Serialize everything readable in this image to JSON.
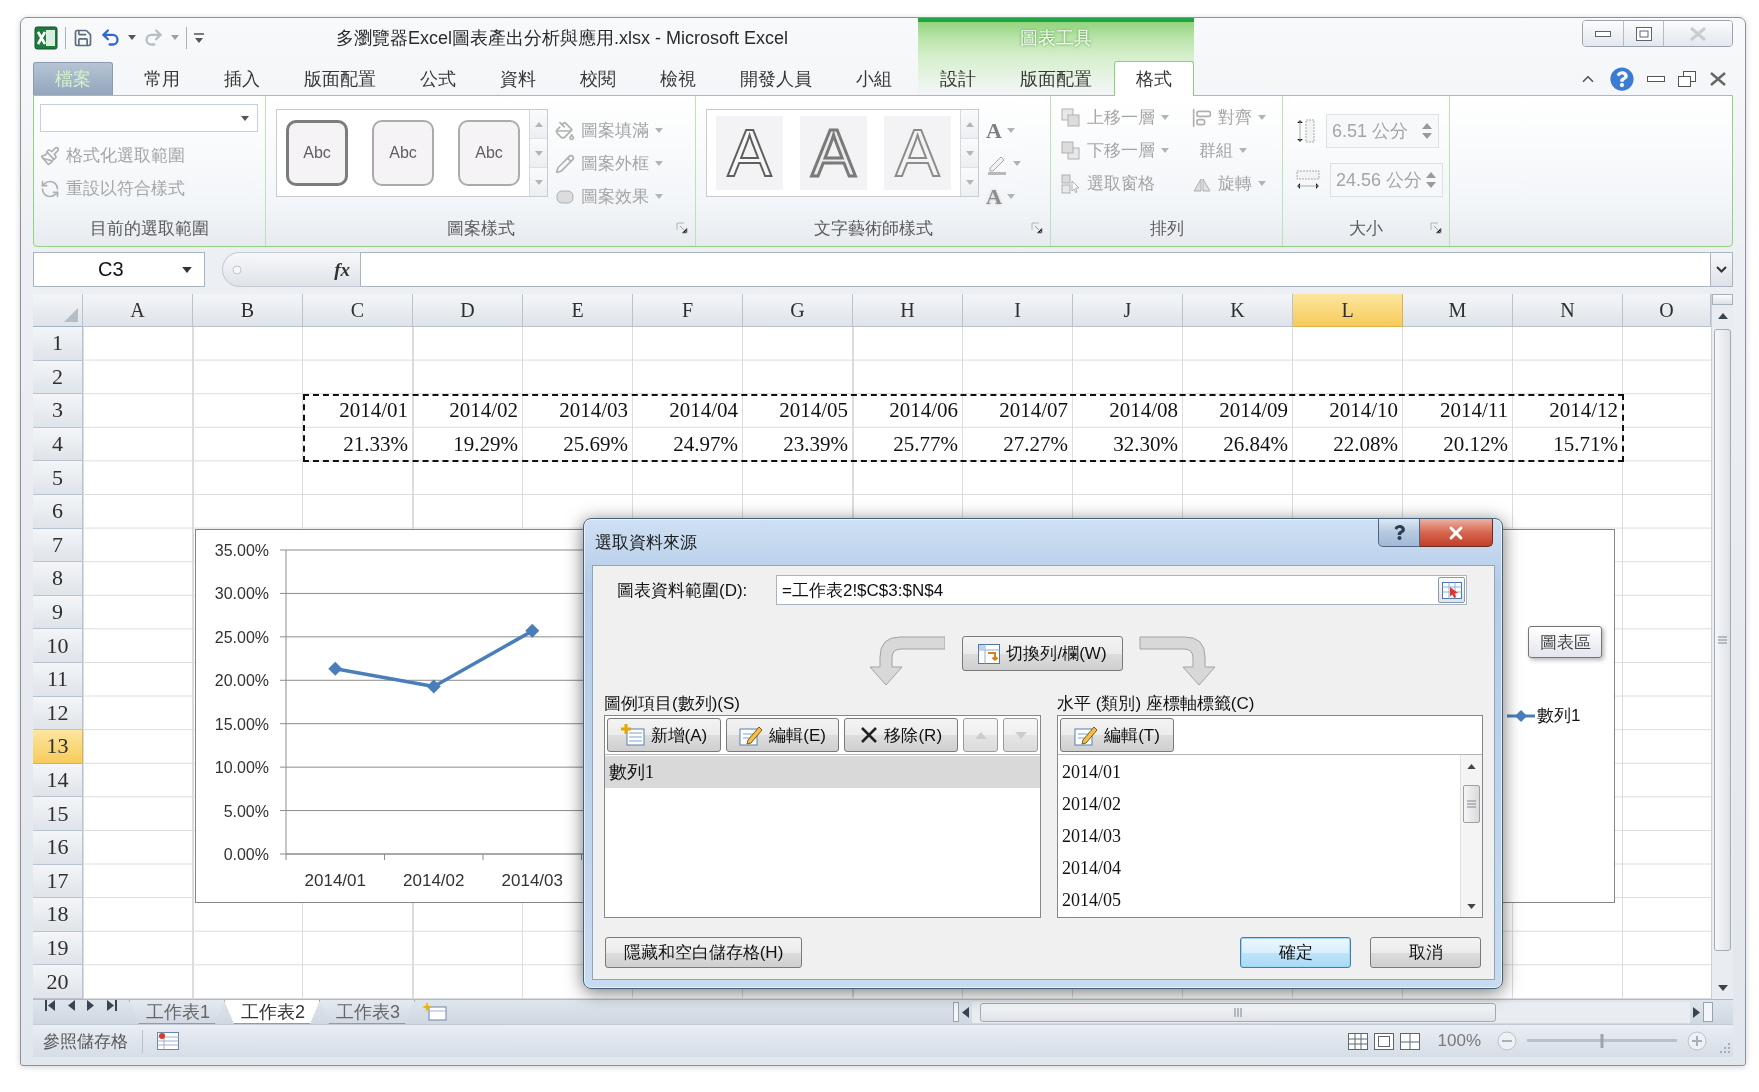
{
  "window": {
    "title": "多瀏覽器Excel圖表產出分析與應用.xlsx - Microsoft Excel",
    "context_header": "圖表工具"
  },
  "quick_access": [
    {
      "kind": "save",
      "disabled": false
    },
    {
      "kind": "undo",
      "disabled": false
    },
    {
      "kind": "redo",
      "disabled": true
    }
  ],
  "tabs": [
    {
      "label": "檔案",
      "kind": "file",
      "selected": false
    },
    {
      "label": "常用",
      "kind": "main",
      "selected": false
    },
    {
      "label": "插入",
      "kind": "main",
      "selected": false
    },
    {
      "label": "版面配置",
      "kind": "main",
      "selected": false
    },
    {
      "label": "公式",
      "kind": "main",
      "selected": false
    },
    {
      "label": "資料",
      "kind": "main",
      "selected": false
    },
    {
      "label": "校閱",
      "kind": "main",
      "selected": false
    },
    {
      "label": "檢視",
      "kind": "main",
      "selected": false
    },
    {
      "label": "開發人員",
      "kind": "main",
      "selected": false
    },
    {
      "label": "小組",
      "kind": "main",
      "selected": false
    },
    {
      "label": "設計",
      "kind": "context",
      "selected": false
    },
    {
      "label": "版面配置",
      "kind": "context",
      "selected": false
    },
    {
      "label": "格式",
      "kind": "context",
      "selected": true
    }
  ],
  "ribbon": {
    "disabled": true,
    "groups": [
      {
        "kind": "selection",
        "label": "目前的選取範圍",
        "launcher": false,
        "commands": [
          {
            "kind": "format_selection",
            "label": "格式化選取範圍",
            "dropdown": false
          },
          {
            "kind": "reset_style",
            "label": "重設以符合樣式",
            "dropdown": false
          }
        ]
      },
      {
        "kind": "shape_styles",
        "label": "圖案樣式",
        "launcher": true,
        "gallery": [
          {
            "label": "Abc",
            "kind": "bold_outline"
          },
          {
            "label": "Abc",
            "kind": "thin_outline"
          },
          {
            "label": "Abc",
            "kind": "thin_outline"
          }
        ],
        "commands": [
          {
            "kind": "shape_fill",
            "label": "圖案填滿",
            "dropdown": true
          },
          {
            "kind": "shape_outline",
            "label": "圖案外框",
            "dropdown": true
          },
          {
            "kind": "shape_effects",
            "label": "圖案效果",
            "dropdown": true
          }
        ]
      },
      {
        "kind": "wordart_styles",
        "label": "文字藝術師樣式",
        "launcher": true,
        "gallery": [
          {
            "label": "A",
            "kind": "outline"
          },
          {
            "label": "A",
            "kind": "thick_outline"
          },
          {
            "label": "A",
            "kind": "soft_outline"
          }
        ],
        "tools": [
          {
            "kind": "text_fill",
            "glyph": "A",
            "dropdown": true
          },
          {
            "kind": "text_outline",
            "dropdown": true
          },
          {
            "kind": "text_effects",
            "glyph": "A",
            "dropdown": true
          }
        ]
      },
      {
        "kind": "arrange",
        "label": "排列",
        "launcher": false,
        "commands": [
          {
            "kind": "bring_forward",
            "label": "上移一層",
            "dropdown": true
          },
          {
            "kind": "send_backward",
            "label": "下移一層",
            "dropdown": true
          },
          {
            "kind": "selection_pane",
            "label": "選取窗格",
            "dropdown": false
          },
          {
            "kind": "align",
            "label": "對齊",
            "dropdown": true
          },
          {
            "kind": "group",
            "label": "群組",
            "dropdown": true
          },
          {
            "kind": "rotate",
            "label": "旋轉",
            "dropdown": true
          }
        ]
      },
      {
        "kind": "size",
        "label": "大小",
        "launcher": true,
        "fields": [
          {
            "kind": "height",
            "value": "6.51 公分"
          },
          {
            "kind": "width",
            "value": "24.56 公分"
          }
        ]
      }
    ]
  },
  "formula_bar": {
    "name_box": "C3",
    "function_label": "fx"
  },
  "sheet": {
    "marquee": true,
    "columns": [
      {
        "label": "A",
        "selected": false
      },
      {
        "label": "B",
        "selected": false
      },
      {
        "label": "C",
        "selected": false
      },
      {
        "label": "D",
        "selected": false
      },
      {
        "label": "E",
        "selected": false
      },
      {
        "label": "F",
        "selected": false
      },
      {
        "label": "G",
        "selected": false
      },
      {
        "label": "H",
        "selected": false
      },
      {
        "label": "I",
        "selected": false
      },
      {
        "label": "J",
        "selected": false
      },
      {
        "label": "K",
        "selected": false
      },
      {
        "label": "L",
        "selected": true
      },
      {
        "label": "M",
        "selected": false
      },
      {
        "label": "N",
        "selected": false
      },
      {
        "label": "O",
        "selected": false
      }
    ],
    "rows": [
      {
        "label": "1",
        "selected": false
      },
      {
        "label": "2",
        "selected": false
      },
      {
        "label": "3",
        "selected": false,
        "cells": [
          null,
          null,
          "2014/01",
          "2014/02",
          "2014/03",
          "2014/04",
          "2014/05",
          "2014/06",
          "2014/07",
          "2014/08",
          "2014/09",
          "2014/10",
          "2014/11",
          "2014/12"
        ]
      },
      {
        "label": "4",
        "selected": false,
        "cells": [
          null,
          null,
          "21.33%",
          "19.29%",
          "25.69%",
          "24.97%",
          "23.39%",
          "25.77%",
          "27.27%",
          "32.30%",
          "26.84%",
          "22.08%",
          "20.12%",
          "15.71%"
        ]
      },
      {
        "label": "5",
        "selected": false
      },
      {
        "label": "6",
        "selected": false
      },
      {
        "label": "7",
        "selected": false
      },
      {
        "label": "8",
        "selected": false
      },
      {
        "label": "9",
        "selected": false
      },
      {
        "label": "10",
        "selected": false
      },
      {
        "label": "11",
        "selected": false
      },
      {
        "label": "12",
        "selected": false
      },
      {
        "label": "13",
        "selected": true
      },
      {
        "label": "14",
        "selected": false
      },
      {
        "label": "15",
        "selected": false
      },
      {
        "label": "16",
        "selected": false
      },
      {
        "label": "17",
        "selected": false
      },
      {
        "label": "18",
        "selected": false
      },
      {
        "label": "19",
        "selected": false
      },
      {
        "label": "20",
        "selected": false
      }
    ]
  },
  "chart": {
    "tooltip": "圖表區",
    "chart_data": {
      "type": "line",
      "grid": true,
      "categories": [
        "2014/01",
        "2014/02",
        "2014/03"
      ],
      "series": [
        {
          "name": "數列1",
          "color": "#4a7ebb",
          "marker": "diamond",
          "values": [
            21.33,
            19.29,
            25.69
          ]
        }
      ],
      "ylim": [
        0,
        35
      ],
      "yticks": [
        {
          "value": 0,
          "label": "0.00%"
        },
        {
          "value": 5,
          "label": "5.00%"
        },
        {
          "value": 10,
          "label": "10.00%"
        },
        {
          "value": 15,
          "label": "15.00%"
        },
        {
          "value": 20,
          "label": "20.00%"
        },
        {
          "value": 25,
          "label": "25.00%"
        },
        {
          "value": 30,
          "label": "30.00%"
        },
        {
          "value": 35,
          "label": "35.00%"
        }
      ]
    }
  },
  "dialog": {
    "title": "選取資料來源",
    "range_label": "圖表資料範圍(D):",
    "range_value": "=工作表2!$C$3:$N$4",
    "switch_button": "切換列/欄(W)",
    "series_panel": {
      "label": "圖例項目(數列)(S)",
      "buttons": [
        {
          "kind": "add",
          "label": "新增(A)",
          "disabled": false
        },
        {
          "kind": "edit",
          "label": "編輯(E)",
          "disabled": false
        },
        {
          "kind": "remove",
          "label": "移除(R)",
          "disabled": false
        },
        {
          "kind": "move_up",
          "disabled": true
        },
        {
          "kind": "move_down",
          "disabled": true
        }
      ],
      "items": [
        {
          "label": "數列1",
          "selected": true
        }
      ]
    },
    "axis_panel": {
      "label": "水平 (類別) 座標軸標籤(C)",
      "buttons": [
        {
          "kind": "edit",
          "label": "編輯(T)",
          "disabled": false
        }
      ],
      "items": [
        {
          "label": "2014/01",
          "selected": false
        },
        {
          "label": "2014/02",
          "selected": false
        },
        {
          "label": "2014/03",
          "selected": false
        },
        {
          "label": "2014/04",
          "selected": false
        },
        {
          "label": "2014/05",
          "selected": false
        }
      ]
    },
    "hidden_cells_button": "隱藏和空白儲存格(H)",
    "ok_button": "確定",
    "cancel_button": "取消"
  },
  "sheet_tabs": [
    {
      "label": "工作表1",
      "selected": false
    },
    {
      "label": "工作表2",
      "selected": true
    },
    {
      "label": "工作表3",
      "selected": false
    }
  ],
  "status_bar": {
    "mode": "參照儲存格",
    "zoom": "100%",
    "zoom_slider": {
      "level": 0.5
    }
  }
}
